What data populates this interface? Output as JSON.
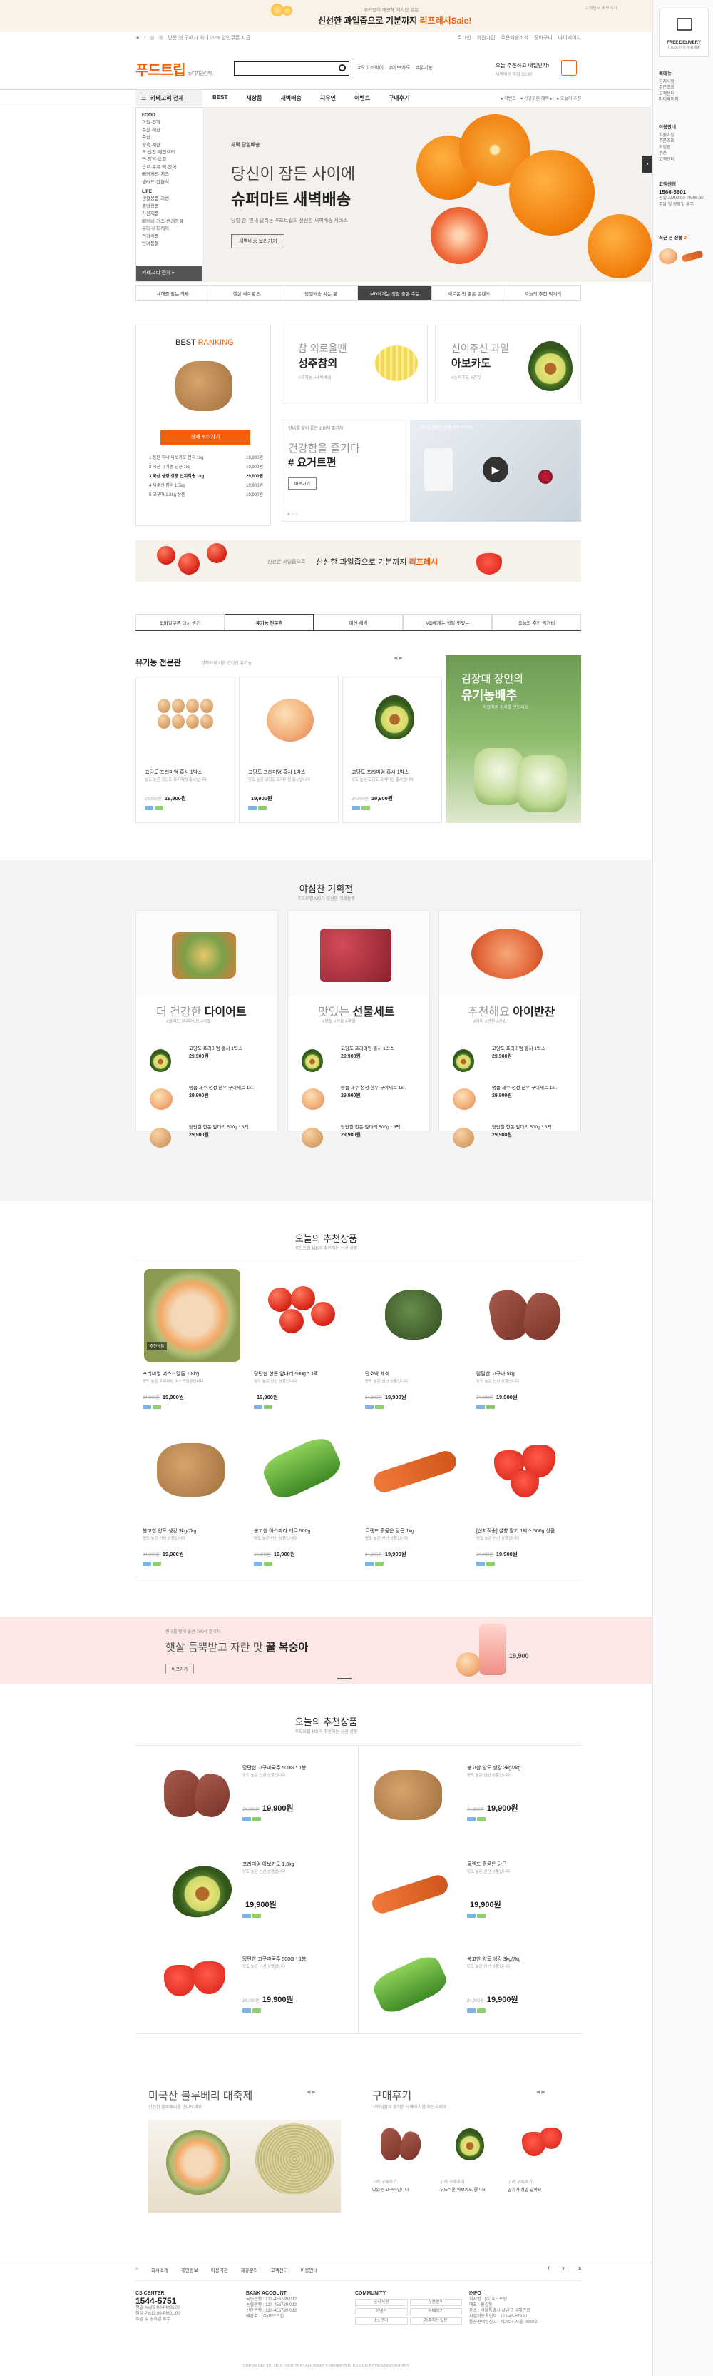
{
  "topbanner": {
    "line1": "우리집이 깨끗해 지지만 같은",
    "line2": "신선한 과일즙으로 기분까지",
    "highlight": "리프레시Sale!",
    "right": "고객센터 바로가기"
  },
  "util": {
    "left": [
      "★",
      "f",
      "◎",
      "Ⓝ"
    ],
    "promo": "방문 첫 구매시 최대 20% 할인쿠폰 지급",
    "links": [
      "로그인",
      "회원가입",
      "주문배송조회",
      "장바구니",
      "마이페이지"
    ]
  },
  "header": {
    "logo": "푸드트립",
    "logo_sub": "by 디자인컴퍼니",
    "keywords": [
      "#오이소박이",
      "#아보카도",
      "#유기농"
    ],
    "delivery_q": "오늘 주문하고 내일받자!",
    "delivery_sub": "새벽배송 마감 23:00"
  },
  "nav": {
    "cat_label": "카테고리 전체",
    "items": [
      "BEST",
      "새상품",
      "새벽배송",
      "지유인",
      "이벤트",
      "구매후기"
    ],
    "right": [
      "● 이벤트",
      "♥ 신규회원 혜택 ▸",
      "● 오늘의 추천"
    ]
  },
  "cat": {
    "groups": [
      {
        "head": "FOOD",
        "items": [
          "과일·견과",
          "수산·해산",
          "축산",
          "정육·계란",
          "국·반찬·메인요리",
          "면·양념·오일",
          "음료·우유·떡·간식",
          "베이커리·치즈",
          "샐러드·간편식"
        ]
      },
      {
        "head": "LIFE",
        "items": [
          "생활용품·리빙",
          "주방용품",
          "가전제품",
          "베이비·키즈·반려동물",
          "뷰티·바디케어",
          "건강식품",
          "반려동물"
        ]
      }
    ],
    "bottom": "카테고리 전체 ▸"
  },
  "hero": {
    "eyebrow": "새벽 당일배송",
    "line1": "당신이 잠든 사이에",
    "line2": "슈퍼마트 새벽배송",
    "sub": "당일 밤, 밤새 달리는 푸드트립의 신선한 새벽배송 서비스",
    "button": "새벽배송 보러가기"
  },
  "tabs": [
    "새해를 맞는 하루",
    "햇살 새로운 맛",
    "당일배송 사는 분",
    "MD에게는 정말 좋은 주문",
    "새로운 맛 좋은 콘텐츠",
    "오늘의 추천 먹거리"
  ],
  "ranking": {
    "title_a": "BEST",
    "title_b": "RANKING",
    "button": "상세 보러가기",
    "rows": [
      {
        "n": "1",
        "name": "동탄 하나 아보카도 전국 1kg",
        "price": "19,900원"
      },
      {
        "n": "2",
        "name": "국산 유기농 당근 1kg",
        "price": "19,900원"
      },
      {
        "n": "3",
        "name": "국산 생강 상품 산지직송 1kg",
        "price": "29,900원"
      },
      {
        "n": "4",
        "name": "제주산 참외 1.5kg",
        "price": "19,900원"
      },
      {
        "n": "5",
        "name": "고구마 1.8kg 상품",
        "price": "19,900원"
      }
    ]
  },
  "promo1": {
    "small": "참 외로울땐",
    "big": "성주참외",
    "sub": "#유기농 #새벽배송"
  },
  "promo2": {
    "small": "신이주신 과일",
    "big": "아보카도",
    "sub": "#슈퍼푸드 #건강"
  },
  "promo3": {
    "small": "장내를 맞이 좋은 100세 즐기자",
    "mid": "건강함을 즐기다",
    "big": "# 요거트편",
    "button": "바로가기"
  },
  "video": {
    "caption": "그래서 달콤한 맛에 계속 먹어요"
  },
  "strip": {
    "small": "신선한 과일즙으로",
    "big": "신선한 과일즙으로 기분까지",
    "hl": "리프레시"
  },
  "tabs2": [
    "모바일쿠폰 다시 받기",
    "유기농 전문관",
    "미산 새벽",
    "MD에게는 정말 맛있는",
    "오늘의 추천 먹거리"
  ],
  "organic": {
    "title": "유기농 전문관",
    "sub": "정직하게 기른 건강한 유기농",
    "banner_small": "김장대 장인의",
    "banner_big": "유기농배추",
    "banner_sub": "직접기른 김치를 만드세요"
  },
  "organic_items": [
    {
      "name": "고당도 프리미엄 홍시 1박스",
      "desc": "당도 높은 고당도 프리미엄 홍시입니다",
      "old": "24,900원",
      "price": "19,900원"
    },
    {
      "name": "고당도 프리미엄 홍시 1박스",
      "desc": "당도 높은 고당도 프리미엄 홍시입니다",
      "old": "",
      "price": "19,900원"
    },
    {
      "name": "고당도 프리미엄 홍시 1박스",
      "desc": "당도 높은 고당도 프리미엄 홍시입니다",
      "old": "24,900원",
      "price": "19,900원"
    }
  ],
  "plan": {
    "title": "야심찬 기획전",
    "sub": "푸드트립 MD가 엄선한 기획상품",
    "cols": [
      {
        "pre": "더 건강한",
        "key": "다이어트",
        "sub": "#샐러드 #다이어트 #곡물"
      },
      {
        "pre": "맛있는",
        "key": "선물세트",
        "sub": "#명절 #선물 #과일"
      },
      {
        "pre": "추천해요",
        "key": "아이반찬",
        "sub": "#아이 #반찬 #건강"
      }
    ],
    "items": [
      {
        "name": "고당도 프리미엄 홍시 1박스",
        "price": "29,900원"
      },
      {
        "name": "명품 제주 청정 한우 구이세트 1k..",
        "price": "29,900원"
      },
      {
        "name": "당단한 한돈 앞다리 500g * 3팩",
        "price": "29,900원"
      }
    ]
  },
  "rec1": {
    "title": "오늘의 추천상품",
    "sub": "푸드트립 MD가 추천하는 신선 상품",
    "items": [
      {
        "name": "프리미엄 머스크멜론 1.8kg",
        "desc": "당도 높은 프리미엄 머스크멜론입니다",
        "old": "24,900원",
        "price": "19,900원",
        "badge": "추천상품"
      },
      {
        "name": "당단한 한돈 앞다리 500g * 3팩",
        "desc": "당도 높은 신선 상품입니다",
        "old": "",
        "price": "19,900원",
        "badge": ""
      },
      {
        "name": "단호박 세척",
        "desc": "당도 높은 신선 상품입니다",
        "old": "24,900원",
        "price": "19,900원",
        "badge": ""
      },
      {
        "name": "달달한 고구마 5kg",
        "desc": "당도 높은 신선 상품입니다",
        "old": "24,900원",
        "price": "19,900원",
        "badge": ""
      },
      {
        "name": "봉고한 양도 생강 3kg/7kg",
        "desc": "당도 높은 신선 상품입니다",
        "old": "24,900원",
        "price": "19,900원",
        "badge": ""
      },
      {
        "name": "봉고한 아스파라 테르 500g",
        "desc": "당도 높은 신선 상품입니다",
        "old": "24,900원",
        "price": "19,900원",
        "badge": ""
      },
      {
        "name": "트렌드 흙묻은 당근 1kg",
        "desc": "당도 높은 신선 상품입니다",
        "old": "24,900원",
        "price": "19,900원",
        "badge": ""
      },
      {
        "name": "[산지직송] 설향 딸기 1박스 500g 상품",
        "desc": "당도 높은 신선 상품입니다",
        "old": "24,900원",
        "price": "19,900원",
        "badge": ""
      }
    ]
  },
  "peach": {
    "small": "장내를 맞이 좋은 100세 즐기자",
    "line": "햇살 듬뿍받고 자란 맛",
    "key": "꿀 복숭아",
    "btn": "바로가기",
    "price": "19,900"
  },
  "rec2": {
    "title": "오늘의 추천상품",
    "sub": "푸드트립 MD가 추천하는 신선 상품",
    "items": [
      {
        "name": "당단한 고구마국주 500G * 1봉",
        "desc": "당도 높은 신선 상품입니다",
        "old": "24,900원",
        "price": "19,900원"
      },
      {
        "name": "봉고한 양도 생강 3kg/7kg",
        "desc": "당도 높은 신선 상품입니다",
        "old": "24,900원",
        "price": "19,900원"
      },
      {
        "name": "프리미엄 아보카도 1.8kg",
        "desc": "당도 높은 신선 상품입니다",
        "old": "",
        "price": "19,900원"
      },
      {
        "name": "트렌드 흙묻은 당근",
        "desc": "당도 높은 신선 상품입니다",
        "old": "",
        "price": "19,900원"
      },
      {
        "name": "당단한 고구마국주 500G * 1봉",
        "desc": "당도 높은 신선 상품입니다",
        "old": "24,900원",
        "price": "19,900원"
      },
      {
        "name": "봉고한 양도 생강 3kg/7kg",
        "desc": "당도 높은 신선 상품입니다",
        "old": "24,900원",
        "price": "19,900원"
      }
    ]
  },
  "melon": {
    "title": "미국산 블루베리 대축제",
    "sub": "신선한 블루베리를 만나보세요"
  },
  "review": {
    "title": "구매후기",
    "sub": "고객님들의 솔직한 구매후기를 확인하세요",
    "items": [
      {
        "name": "고객 구매후기",
        "text": "맛있는 고구마입니다"
      },
      {
        "name": "고객 구매후기",
        "text": "부드러운 아보카도 좋아요"
      },
      {
        "name": "고객 구매후기",
        "text": "딸기가 정말 달아요"
      }
    ]
  },
  "footer": {
    "menu": [
      "회사소개",
      "개인정보",
      "이용약관",
      "제휴문의",
      "고객센터",
      "이용안내"
    ],
    "cs_label": "CS CENTER",
    "cs_phone": "1544-5751",
    "cs_lines": [
      "평일 AM09:00-PM06:00",
      "점심 PM12:00-PM01:00",
      "주말 및 공휴일 휴무"
    ],
    "bank_label": "BANK ACCOUNT",
    "bank_lines": [
      "국민은행 : 123-456789-012",
      "농협은행 : 123-456789-012",
      "신한은행 : 123-456789-012",
      "예금주 : (주)푸드트립"
    ],
    "comm_label": "COMMUNITY",
    "comm": [
      "공지사항",
      "상품문의",
      "이벤트",
      "구매후기",
      "1:1문의",
      "자주하는질문"
    ],
    "info_label": "INFO",
    "info_lines": [
      "회사명 : (주)푸드트립",
      "대표 : 홍길동",
      "주소 : 서울특별시 강남구 테헤란로",
      "사업자등록번호 : 123-45-67890",
      "통신판매업신고 : 제2024-서울-0000호"
    ],
    "copy": "COPYRIGHT (C) 2019 FOODTRIP. ALL RIGHTS RESERVED. DESIGN BY DESIGNCOMPANY"
  },
  "rbar": {
    "badge_a": "FREE DELIVERY",
    "badge_b": "70,000 이상 무료배송",
    "quick_label": "퀵메뉴",
    "quick": [
      "공지사항",
      "주문조회",
      "고객센터",
      "마이페이지"
    ],
    "cs_label": "이용안내",
    "cs": [
      "회원가입",
      "주문조회",
      "적립금",
      "쿠폰",
      "고객센터"
    ],
    "tel_label": "고객센터",
    "tel": "1566-6601",
    "tel_sub": [
      "평일 AM09:00-PM06:00",
      "주말 및 공휴일 휴무"
    ],
    "recent": "최근 본 상품",
    "recent_count": "2"
  },
  "colors": {
    "accent": "#f2600a",
    "dark": "#444444",
    "light_bg": "#f4f4f4"
  }
}
